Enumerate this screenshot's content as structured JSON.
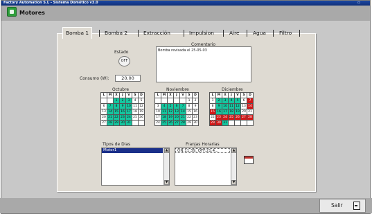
{
  "window": {
    "title": "Factory Automation S.L - Sistema Domótico v3.0"
  },
  "header": {
    "module_title": "Motores"
  },
  "tabs": [
    {
      "label": "Bomba 1",
      "active": true
    },
    {
      "label": "Bomba 2",
      "active": false
    },
    {
      "label": "Extracción",
      "active": false
    },
    {
      "label": "Impulsion",
      "active": false
    },
    {
      "label": "Aire",
      "active": false
    },
    {
      "label": "Agua",
      "active": false
    },
    {
      "label": "Filtro",
      "active": false
    }
  ],
  "form": {
    "estado_label": "Estado",
    "estado_value": "OFF",
    "consumo_label": "Consumo (W):",
    "consumo_value": "20.00",
    "comentario_label": "Comentario",
    "comentario_value": "Bomba revisada el 25-05-03"
  },
  "calendars": [
    {
      "month": "Octubre",
      "days": [
        "L",
        "M",
        "X",
        "J",
        "V",
        "S",
        "D"
      ],
      "weeks": [
        [
          "",
          "",
          "1",
          "2",
          "3",
          "4",
          "5"
        ],
        [
          "6",
          "7",
          "8",
          "9",
          "10",
          "11",
          "12"
        ],
        [
          "13",
          "14",
          "15",
          "16",
          "17",
          "18",
          "19"
        ],
        [
          "20",
          "21",
          "22",
          "23",
          "24",
          "25",
          "26"
        ],
        [
          "27",
          "28",
          "29",
          "30",
          "31",
          "",
          ""
        ]
      ]
    },
    {
      "month": "Noviembre",
      "days": [
        "L",
        "M",
        "X",
        "J",
        "V",
        "S",
        "D"
      ],
      "weeks": [
        [
          "",
          "",
          "",
          "",
          "",
          "1",
          "2"
        ],
        [
          "3",
          "4",
          "5",
          "6",
          "7",
          "8",
          "9"
        ],
        [
          "10",
          "11",
          "12",
          "13",
          "14",
          "15",
          "16"
        ],
        [
          "17",
          "18",
          "19",
          "20",
          "21",
          "22",
          "23"
        ],
        [
          "24",
          "25",
          "26",
          "27",
          "28",
          "29",
          "30"
        ]
      ]
    },
    {
      "month": "Diciembre",
      "days": [
        "L",
        "M",
        "X",
        "J",
        "V",
        "S",
        "D"
      ],
      "weeks": [
        [
          "1",
          "2",
          "3",
          "4",
          "5",
          "6",
          "7"
        ],
        [
          "8",
          "9",
          "10",
          "11",
          "12",
          "13",
          "14"
        ],
        [
          "15",
          "16",
          "17",
          "18",
          "19",
          "20",
          "21"
        ],
        [
          "22",
          "23",
          "24",
          "25",
          "26",
          "27",
          "28"
        ],
        [
          "29",
          "30",
          "31",
          "",
          "",
          "",
          ""
        ]
      ]
    }
  ],
  "day_types": {
    "label": "Tipos de Dias",
    "items": [
      "Motor1"
    ]
  },
  "time_slots": {
    "label": "Franjas Horarias",
    "items": [
      "ON:11:39, OFF:21:4..."
    ]
  },
  "footer": {
    "exit_label": "Salir"
  },
  "colors": {
    "active_day": "#15c7a0",
    "holiday": "#d11717",
    "title_bar": "#1b47a3"
  }
}
